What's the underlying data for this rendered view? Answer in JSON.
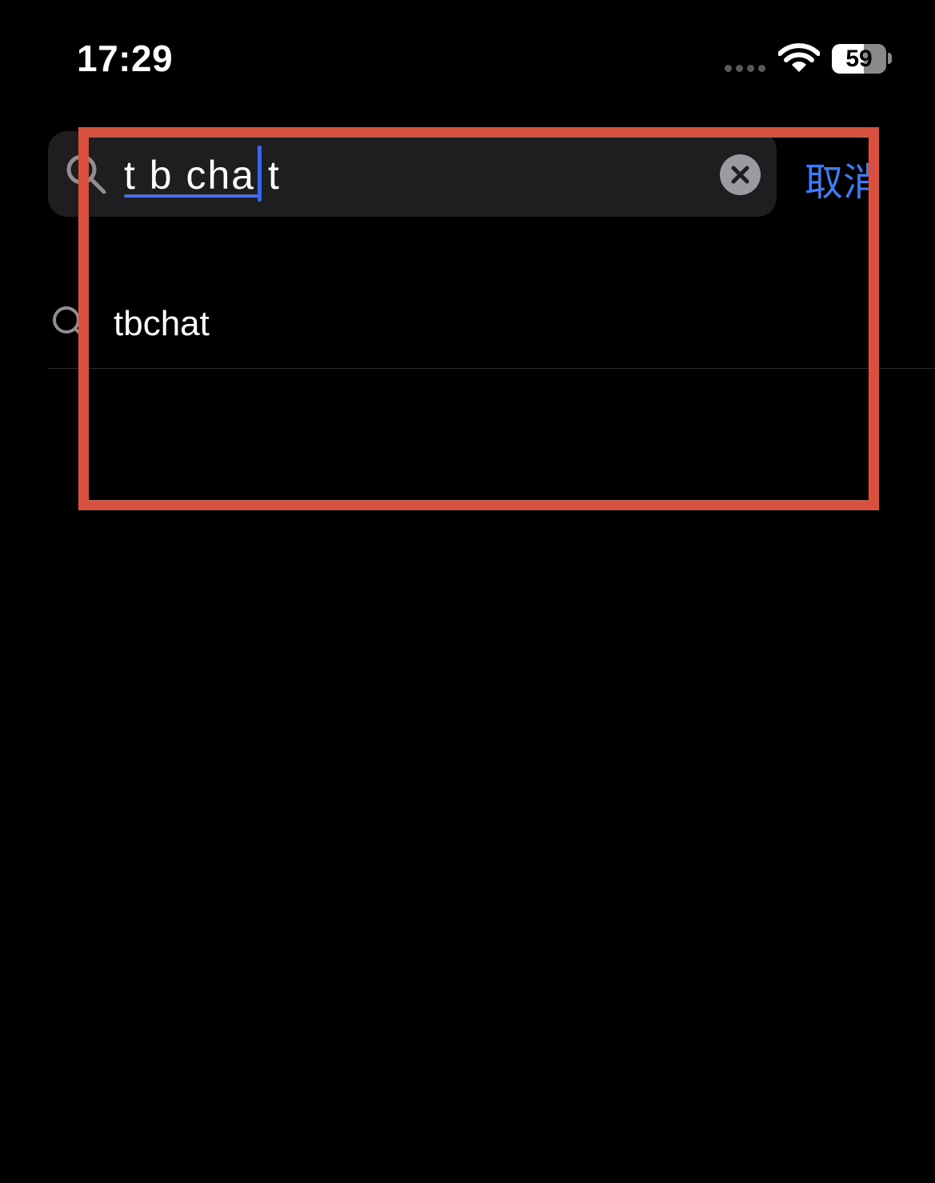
{
  "status_bar": {
    "time": "17:29",
    "battery_level": "59",
    "icons": [
      "signal-dots-icon",
      "wifi-icon",
      "battery-icon"
    ]
  },
  "search": {
    "query": "t b cha t",
    "cancel_label": "取消",
    "icons": [
      "search-icon",
      "clear-icon"
    ]
  },
  "suggestions": [
    {
      "label": "tbchat",
      "icon": "search-icon"
    }
  ],
  "colors": {
    "background": "#000000",
    "search_field": "#1e1e20",
    "accent": "#3f7cf2",
    "cursor": "#3c64e6",
    "highlight_box": "#d7513f"
  }
}
